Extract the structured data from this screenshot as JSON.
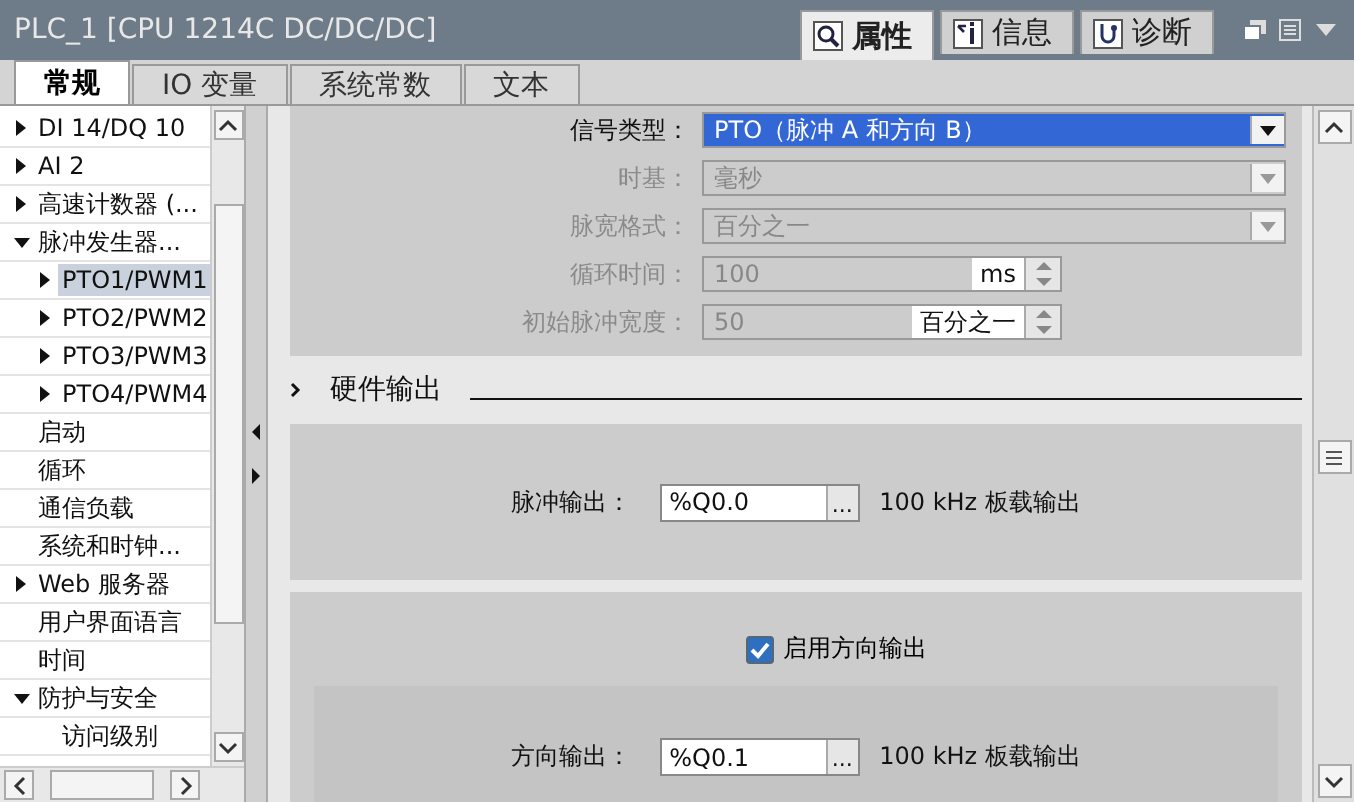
{
  "window": {
    "title": "PLC_1 [CPU 1214C DC/DC/DC]"
  },
  "inspector_tabs": [
    {
      "label": "属性",
      "selected": true
    },
    {
      "label": "信息",
      "selected": false
    },
    {
      "label": "诊断",
      "selected": false
    }
  ],
  "tabs": [
    {
      "label": "常规",
      "selected": true
    },
    {
      "label": "IO 变量",
      "selected": false
    },
    {
      "label": "系统常数",
      "selected": false
    },
    {
      "label": "文本",
      "selected": false
    }
  ],
  "tree": {
    "items": [
      {
        "label": "DI 14/DQ 10",
        "selected": false,
        "expanded": false
      },
      {
        "label": "AI 2",
        "selected": false,
        "expanded": false
      },
      {
        "label": "高速计数器 (...",
        "selected": false,
        "expanded": false
      },
      {
        "label": "脉冲发生器...",
        "selected": false,
        "expanded": true,
        "children": [
          {
            "label": "PTO1/PWM1",
            "selected": true,
            "expanded": false
          },
          {
            "label": "PTO2/PWM2",
            "selected": false,
            "expanded": false
          },
          {
            "label": "PTO3/PWM3",
            "selected": false,
            "expanded": false
          },
          {
            "label": "PTO4/PWM4",
            "selected": false,
            "expanded": false
          }
        ]
      },
      {
        "label": "启动",
        "selected": false
      },
      {
        "label": "循环",
        "selected": false
      },
      {
        "label": "通信负载",
        "selected": false
      },
      {
        "label": "系统和时钟...",
        "selected": false
      },
      {
        "label": "Web 服务器",
        "selected": false,
        "expanded": false
      },
      {
        "label": "用户界面语言",
        "selected": false
      },
      {
        "label": "时间",
        "selected": false
      },
      {
        "label": "防护与安全",
        "selected": false,
        "expanded": true,
        "children": [
          {
            "label": "访问级别",
            "selected": false
          }
        ]
      }
    ]
  },
  "pulse_options": {
    "fields": [
      {
        "kind": "dropdown",
        "label": "信号类型：",
        "value": "PTO（脉冲 A 和方向 B）",
        "disabled": false
      },
      {
        "kind": "dropdown",
        "label": "时基：",
        "value": "毫秒",
        "disabled": true
      },
      {
        "kind": "dropdown",
        "label": "脉宽格式：",
        "value": "百分之一",
        "disabled": true
      },
      {
        "kind": "spin",
        "label": "循环时间：",
        "value": "100",
        "unit": "ms",
        "disabled": true
      },
      {
        "kind": "spin",
        "label": "初始脉冲宽度：",
        "value": "50",
        "unit": "百分之一",
        "disabled": true
      }
    ]
  },
  "hardware_output": {
    "title": "硬件输出",
    "pulse_output": {
      "label": "脉冲输出：",
      "value": "%Q0.0",
      "browse": "...",
      "note": "100 kHz 板载输出"
    },
    "direction_enable": {
      "label": "启用方向输出",
      "checked": true
    },
    "direction_output": {
      "label": "方向输出：",
      "value": "%Q0.1",
      "browse": "...",
      "note": "100 kHz 板载输出"
    }
  }
}
